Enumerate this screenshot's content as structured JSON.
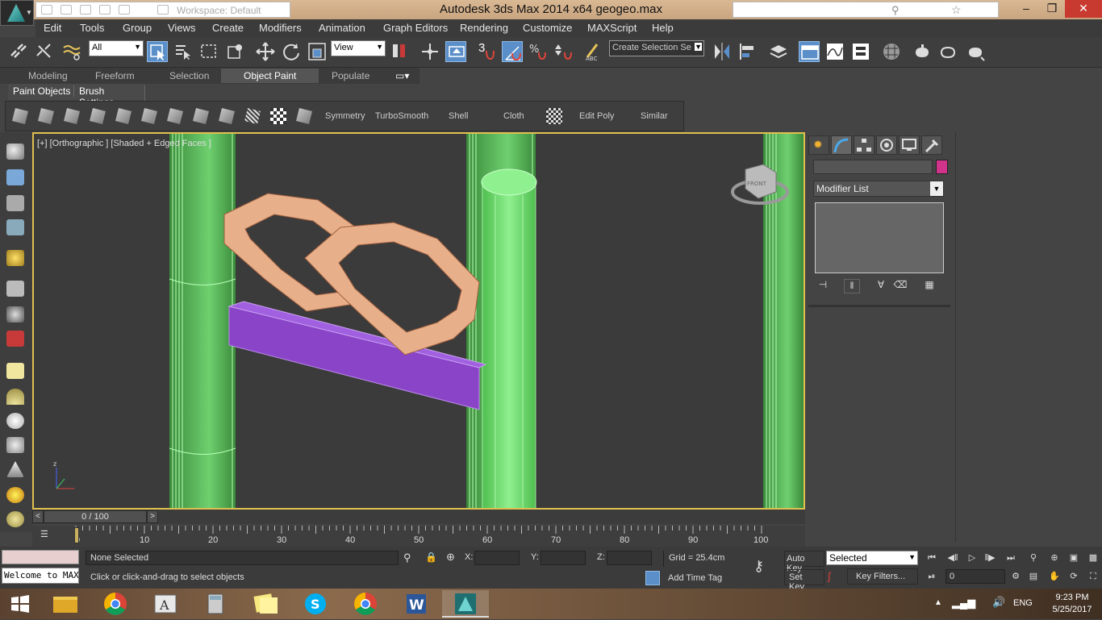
{
  "window": {
    "title": "Autodesk 3ds Max  2014 x64      geogeo.max",
    "workspace_label": "Workspace: Default",
    "minimize": "–",
    "maximize": "❐",
    "close": "✕"
  },
  "menu": [
    "Edit",
    "Tools",
    "Group",
    "Views",
    "Create",
    "Modifiers",
    "Animation",
    "Graph Editors",
    "Rendering",
    "Customize",
    "MAXScript",
    "Help"
  ],
  "main_toolbar": {
    "selection_filter": "All",
    "reference_coord": "View",
    "snap_label": "3",
    "named_selection_placeholder": "Create Selection Se"
  },
  "ribbon": {
    "tabs": [
      "Modeling",
      "Freeform",
      "Selection",
      "Object Paint",
      "Populate"
    ],
    "active_tab": "Object Paint",
    "subtabs": [
      "Paint Objects",
      "Brush Settings"
    ],
    "tools": [
      "Symmetry",
      "TurboSmooth",
      "Shell",
      "Cloth",
      "Edit Poly",
      "Similar"
    ]
  },
  "viewport": {
    "label": "[+] [Orthographic ] [Shaded + Edged Faces ]",
    "viewcube_label": "FRONT"
  },
  "command_panel": {
    "modifier_list": "Modifier List"
  },
  "timeline": {
    "frame_display": "0 / 100",
    "prev": "<",
    "next": ">",
    "ticks": [
      "0",
      "10",
      "20",
      "30",
      "40",
      "50",
      "60",
      "70",
      "80",
      "90",
      "100"
    ]
  },
  "status": {
    "maxscript_text": "Welcome to MAXScript.",
    "selection": "None Selected",
    "prompt": "Click or click-and-drag to select objects",
    "x_label": "X:",
    "y_label": "Y:",
    "z_label": "Z:",
    "grid": "Grid = 25.4cm",
    "add_time_tag": "Add Time Tag",
    "auto_key": "Auto Key",
    "set_key": "Set Key",
    "selected_dropdown": "Selected",
    "key_filters": "Key Filters...",
    "current_frame": "0"
  },
  "taskbar": {
    "language": "ENG",
    "time": "9:23 PM",
    "date": "5/25/2017"
  },
  "colors": {
    "title_bar": "#d2b08a",
    "viewport_border": "#e0c050",
    "column_green": "#7fe07f",
    "ring_orange": "#e8b08a",
    "box_purple": "#8a44c8",
    "object_color": "#d0338a"
  }
}
